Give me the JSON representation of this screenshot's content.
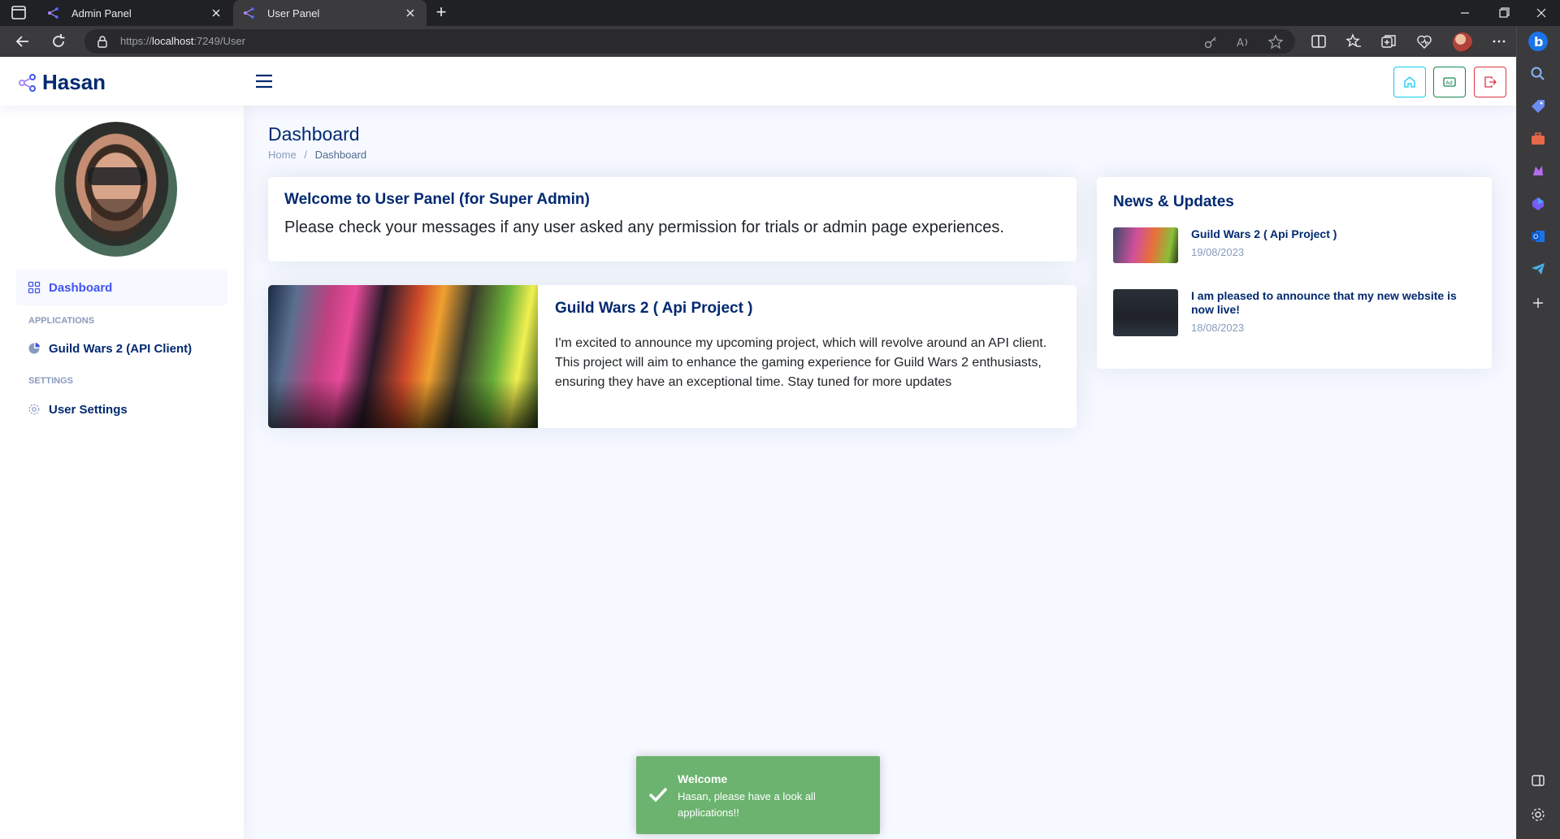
{
  "browser": {
    "tabs": [
      {
        "title": "Admin Panel",
        "active": false
      },
      {
        "title": "User Panel",
        "active": true
      }
    ],
    "url_prefix": "https://",
    "url_host": "localhost",
    "url_rest": ":7249/User"
  },
  "header": {
    "logo_text": "Hasan",
    "buttons": [
      {
        "icon": "house-icon",
        "color": "#0dcaf0"
      },
      {
        "icon": "ad-icon",
        "color": "#198754"
      },
      {
        "icon": "logout-icon",
        "color": "#dc3545"
      }
    ]
  },
  "sidebar": {
    "dashboard": "Dashboard",
    "heading_applications": "Applications",
    "app_item": "Guild Wars 2 (API Client)",
    "heading_settings": "Settings",
    "settings_item": "User Settings"
  },
  "page": {
    "title": "Dashboard",
    "breadcrumb_home": "Home",
    "breadcrumb_sep": "/",
    "breadcrumb_current": "Dashboard"
  },
  "welcome": {
    "title": "Welcome to User Panel (for Super Admin)",
    "text": "Please check your messages if any user asked any permission for trials or admin page experiences."
  },
  "project": {
    "title": "Guild Wars 2 ( Api Project )",
    "text": "I'm excited to announce my upcoming project, which will revolve around an API client. This project will aim to enhance the gaming experience for Guild Wars 2 enthusiasts, ensuring they have an exceptional time. Stay tuned for more updates"
  },
  "news": {
    "title": "News & Updates",
    "items": [
      {
        "title": "Guild Wars 2 ( Api Project )",
        "date": "19/08/2023"
      },
      {
        "title": "I am pleased to announce that my new website is now live!",
        "date": "18/08/2023"
      }
    ]
  },
  "toast": {
    "title": "Welcome",
    "message": "Hasan, please have a look all applications!!"
  },
  "colors": {
    "brand": "#012970",
    "accent": "#4154f1",
    "toast": "#6cb36f"
  }
}
